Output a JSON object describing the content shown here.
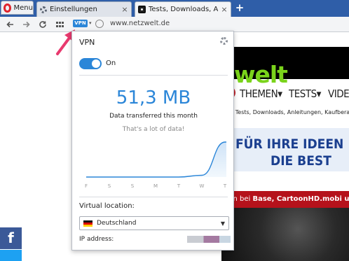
{
  "tabs": {
    "menu_label": "Menu",
    "items": [
      {
        "title": "Einstellungen",
        "icon": "gear-icon"
      },
      {
        "title": "Tests, Downloads, Anleitun",
        "icon": "netzwelt-favicon"
      }
    ],
    "new_tab_label": "+",
    "close_glyph": "×"
  },
  "toolbar": {
    "vpn_badge": "VPN",
    "url": "www.netzwelt.de"
  },
  "website": {
    "logo": "welt",
    "nav": [
      "THEMEN",
      "TESTS",
      "VIDEO"
    ],
    "breadcrumb": "› Tests, Downloads, Anleitungen, Kaufberat",
    "ad_line1": "FÜR IHRE IDEEN",
    "ad_line2": "DIE BEST",
    "red_text_plain": "gen bei ",
    "red_text_bold": "Base, CartoonHD.mobi und",
    "facebook_glyph": "f"
  },
  "vpn_popup": {
    "title": "VPN",
    "toggle_state": "On",
    "data_amount": "51,3 MB",
    "data_caption": "Data transferred this month",
    "data_comment": "That's a lot of data!",
    "usage_chart": {
      "type": "area",
      "days": [
        "F",
        "S",
        "S",
        "M",
        "T",
        "W",
        "T"
      ],
      "values": [
        0,
        0,
        0,
        0,
        0,
        0.05,
        1.0
      ]
    },
    "location_label": "Virtual location:",
    "location_value": "Deutschland",
    "ip_label": "IP address:"
  },
  "colors": {
    "accent": "#2b86d8",
    "tabstrip": "#2f5ea8",
    "logo_green": "#7ad31b",
    "arrow": "#e8396e"
  }
}
